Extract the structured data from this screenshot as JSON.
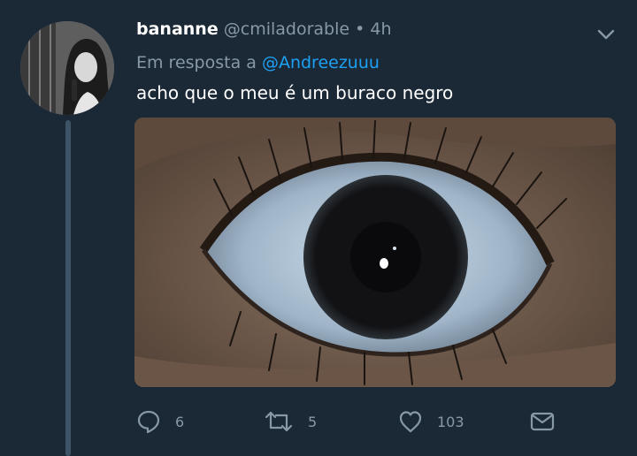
{
  "tweet": {
    "display_name": "bananne",
    "handle": "@cmiladorable",
    "separator": "•",
    "time": "4h",
    "reply_prefix": "Em resposta a",
    "reply_to": "@Andreezuuu",
    "text": "acho que o meu é um buraco negro"
  },
  "actions": {
    "replies": "6",
    "retweets": "5",
    "likes": "103"
  },
  "icons": {
    "reply": "speech-bubble-icon",
    "retweet": "retweet-arrows-icon",
    "like": "heart-icon",
    "dm": "envelope-icon",
    "menu": "chevron-down-icon"
  },
  "colors": {
    "background": "#1b2836",
    "muted": "#8899a6",
    "link": "#1da1f2",
    "thread_line": "#3d5466"
  }
}
